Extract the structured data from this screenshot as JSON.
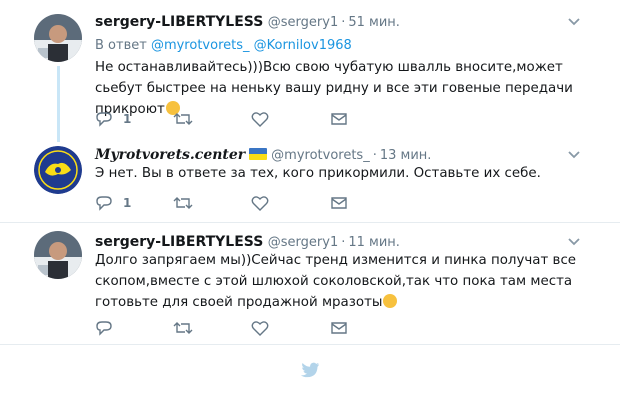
{
  "tweets": [
    {
      "name": "sergery-LIBERTYLESS",
      "handle": "@sergery1",
      "time": "51 мин.",
      "reply_prefix": "В ответ",
      "reply_handle_1": "@myrotvorets_",
      "reply_handle_2": "@Kornilov1968",
      "text": "Не останавливайтесь)))Всю свою чубатую швалль вносите,может сьебут быстрее на неньку вашу ридну и все эти говеные передачи прикроют",
      "reply_count": "1"
    },
    {
      "name": "Myrotvorets.center",
      "handle": "@myrotvorets_",
      "time": "13 мин.",
      "text": "Э нет. Вы в ответе за тех, кого прикормили. Оставьте их себе.",
      "reply_count": "1"
    },
    {
      "name": "sergery-LIBERTYLESS",
      "handle": "@sergery1",
      "time": "11 мин.",
      "text": "Долго запрягаем мы))Сейчас тренд изменится и пинка получат все скопом,вместе с этой шлюхой соколовской,так что пока там места готовьте для своей продажной мразоты"
    }
  ],
  "colors": {
    "link": "#1b95e0",
    "muted": "#657786",
    "thread": "#c9e6f7",
    "divider": "#e6ecf0"
  },
  "icons": [
    "chevron-down-icon",
    "reply-icon",
    "retweet-icon",
    "like-icon",
    "dm-icon",
    "twitter-bird-icon",
    "ukraine-flag-icon"
  ]
}
